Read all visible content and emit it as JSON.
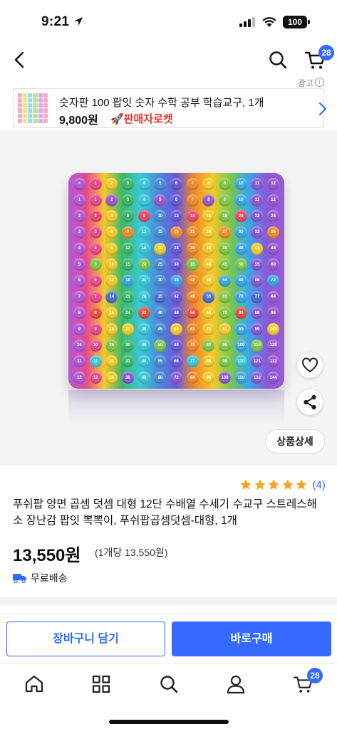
{
  "status_bar": {
    "time": "9:21",
    "battery": "100"
  },
  "nav": {
    "cart_count": "28"
  },
  "ad": {
    "label": "광고",
    "info": "i",
    "title": "숫자판 100 팝잇 숫자 수학 공부 학습교구, 1개",
    "price": "9,800원",
    "badge": "🚀판매자로켓"
  },
  "product_image": {
    "grid_size": 12,
    "row_colors": [
      "#9b59d0",
      "#e84a6a",
      "#f28a2a",
      "#f5c92a",
      "#7cc84a",
      "#3aa7e8",
      "#4a6fd8",
      "#e8503a",
      "#f5c92a",
      "#7cc84a",
      "#3ac8d8",
      "#8a5ad8"
    ],
    "column_colors": [
      "#b05ad8",
      "#e84a8a",
      "#f5c92a",
      "#3ab86a",
      "#3ac8d8",
      "#4a8ad8",
      "#6a5ad8",
      "#f08a2a",
      "#f5c92a",
      "#7cc84a",
      "#3aa7e8",
      "#8a5ad8",
      "#9b59d0"
    ]
  },
  "actions": {
    "detail_label": "상품상세"
  },
  "product": {
    "rating_stars": 5,
    "rating_count": "(4)",
    "title": "푸쉬팝 양면 곱셈 덧셈 대형 12단 수배열 수세기 수교구 스트레스해소 장난감 팝잇 뽁뽁이, 푸쉬팝곱셈덧셈-대형, 1개",
    "price": "13,550원",
    "unit_price": "(1개당 13,550원)",
    "shipping": "무료배송"
  },
  "bottom_actions": {
    "add_to_cart": "장바구니 담기",
    "buy_now": "바로구매"
  },
  "tab_bar": {
    "cart_count": "28"
  },
  "colors": {
    "accent": "#346aff",
    "star": "#f5a623",
    "rocket_red": "#e5332a"
  }
}
